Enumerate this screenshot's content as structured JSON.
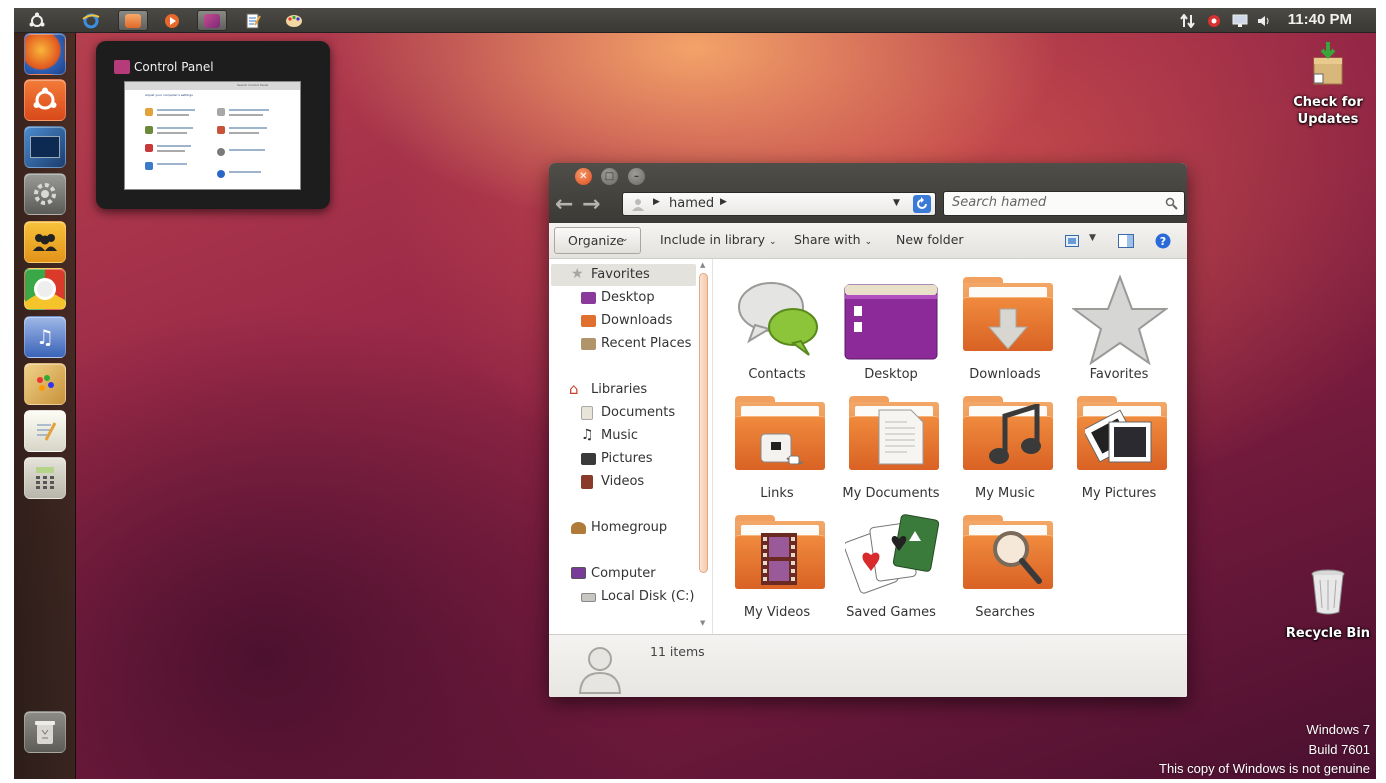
{
  "top_panel": {
    "clock": "11:40 PM",
    "app_icons": [
      "ubuntu-logo-icon",
      "internet-explorer-icon",
      "explorer-folder-icon",
      "media-player-icon",
      "control-panel-icon",
      "wordpad-icon",
      "paint-icon"
    ]
  },
  "launcher": {
    "items": [
      "firefox-icon",
      "ubuntu-software-icon",
      "terminal-icon",
      "settings-gear-icon",
      "people-icon",
      "chrome-icon",
      "itunes-icon",
      "paint-palette-icon",
      "notepad-icon",
      "calculator-icon"
    ],
    "trash": "trash-icon"
  },
  "preview": {
    "title": "Control Panel",
    "thumbnail_heading": "Adjust your computer's settings",
    "thumbnail_search": "Search Control Panel"
  },
  "desktop": {
    "check_updates": "Check for\nUpdates",
    "recycle_bin": "Recycle Bin"
  },
  "explorer": {
    "address": "hamed",
    "search_placeholder": "Search hamed",
    "toolbar": {
      "organize": "Organize",
      "include_library": "Include in library",
      "share_with": "Share with",
      "new_folder": "New folder"
    },
    "sidebar": {
      "favorites": "Favorites",
      "desktop": "Desktop",
      "downloads": "Downloads",
      "recent_places": "Recent Places",
      "libraries": "Libraries",
      "documents": "Documents",
      "music": "Music",
      "pictures": "Pictures",
      "videos": "Videos",
      "homegroup": "Homegroup",
      "computer": "Computer",
      "local_disk": "Local Disk (C:)"
    },
    "tiles": [
      "Contacts",
      "Desktop",
      "Downloads",
      "Favorites",
      "Links",
      "My Documents",
      "My Music",
      "My Pictures",
      "My Videos",
      "Saved Games",
      "Searches"
    ],
    "status": "11 items"
  },
  "watermark": {
    "line1": "Windows 7",
    "line2": "Build 7601",
    "line3": "This copy of Windows is not genuine"
  },
  "colors": {
    "accent_orange": "#e2682a",
    "panel_dark": "#3c3b37",
    "close_button": "#e25c2c"
  }
}
